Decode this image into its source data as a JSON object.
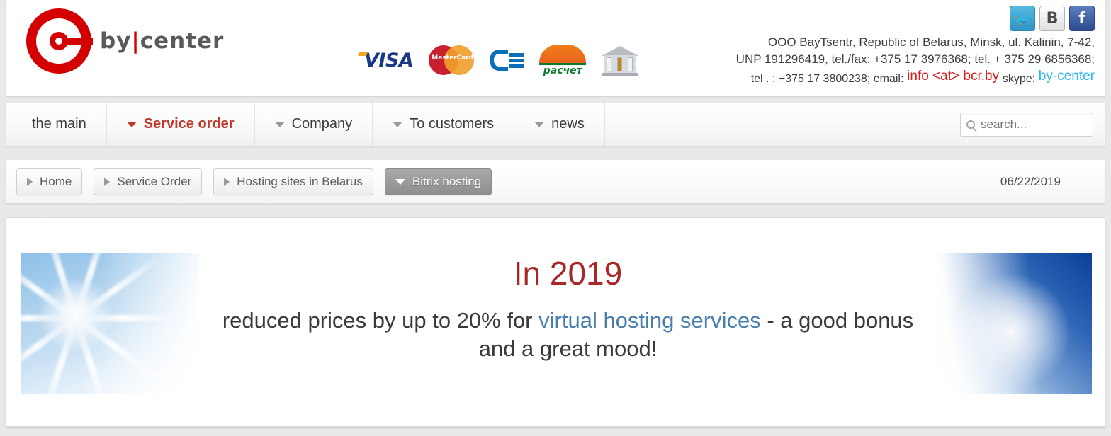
{
  "header": {
    "logo": {
      "text_main": "by",
      "text_bar": "|",
      "text_sub": "center",
      "alt": "by center logo"
    },
    "payment_methods": [
      {
        "name": "visa-icon",
        "label": "VISA"
      },
      {
        "name": "mastercard-icon",
        "label": "MasterCard"
      },
      {
        "name": "erip-icon",
        "label": "ЕРИП"
      },
      {
        "name": "raschet-icon",
        "label": "расчет"
      },
      {
        "name": "bank-transfer-icon",
        "label": "bank"
      }
    ],
    "social": [
      {
        "name": "twitter-icon",
        "glyph": "✈"
      },
      {
        "name": "vk-icon",
        "glyph": "B"
      },
      {
        "name": "facebook-icon",
        "glyph": "f"
      }
    ],
    "contacts": {
      "line1": "OOO BayTsentr, Republic of Belarus, Minsk, ul. Kalinin, 7-42,",
      "line2": "UNP 191296419, tel./fax: +375 17 3976368; tel. + 375 29 6856368;",
      "line3_prefix": "tel . : +375 17 3800238; email:",
      "email": "info <at> bcr.by",
      "skype_label": "skype:",
      "skype": "by-center"
    }
  },
  "nav": {
    "items": [
      {
        "label": "the main",
        "has_chevron": false,
        "active": false
      },
      {
        "label": "Service order",
        "has_chevron": true,
        "active": true
      },
      {
        "label": "Company",
        "has_chevron": true,
        "active": false
      },
      {
        "label": "To customers",
        "has_chevron": true,
        "active": false
      },
      {
        "label": "news",
        "has_chevron": true,
        "active": false
      }
    ],
    "search": {
      "placeholder": "search...",
      "value": ""
    }
  },
  "breadcrumb": {
    "items": [
      {
        "label": "Home",
        "active": false
      },
      {
        "label": "Service Order",
        "active": false
      },
      {
        "label": "Hosting sites in Belarus",
        "active": false
      },
      {
        "label": "Bitrix hosting",
        "active": true
      }
    ],
    "date": "06/22/2019"
  },
  "main": {
    "headline": "In 2019",
    "sub_before": "reduced prices by up to 20% for",
    "sub_link": "virtual hosting services",
    "sub_after": "- a good bonus and a great mood!"
  },
  "colors": {
    "brand_red": "#d40000",
    "accent_red": "#c0392b",
    "headline_red": "#a82828",
    "link_blue": "#4a7fad",
    "email_red": "#e01b1b",
    "skype_blue": "#29b6f6"
  }
}
